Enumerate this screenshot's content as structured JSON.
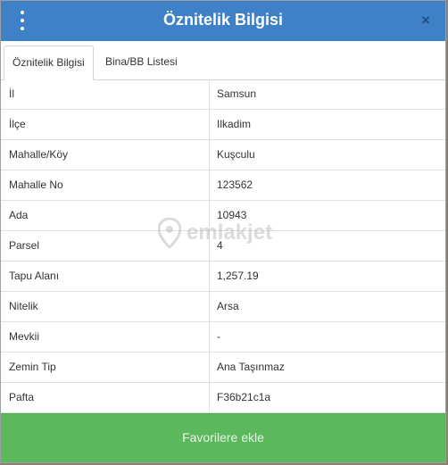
{
  "header": {
    "title": "Öznitelik Bilgisi",
    "menu_icon": "kebab-menu-icon",
    "close_label": "×"
  },
  "tabs": [
    {
      "label": "Öznitelik Bilgisi",
      "active": true
    },
    {
      "label": "Bina/BB Listesi",
      "active": false
    }
  ],
  "rows": [
    {
      "label": "İl",
      "value": "Samsun"
    },
    {
      "label": "İlçe",
      "value": "Ilkadim"
    },
    {
      "label": "Mahalle/Köy",
      "value": "Kuşculu"
    },
    {
      "label": "Mahalle No",
      "value": "123562"
    },
    {
      "label": "Ada",
      "value": "10943"
    },
    {
      "label": "Parsel",
      "value": "4"
    },
    {
      "label": "Tapu Alanı",
      "value": "1,257.19"
    },
    {
      "label": "Nitelik",
      "value": "Arsa"
    },
    {
      "label": "Mevkii",
      "value": "-"
    },
    {
      "label": "Zemin Tip",
      "value": "Ana Taşınmaz"
    },
    {
      "label": "Pafta",
      "value": "F36b21c1a"
    }
  ],
  "watermark": {
    "text": "emlakjet"
  },
  "footer": {
    "button_label": "Favorilere ekle"
  },
  "colors": {
    "header": "#3f81c6",
    "button": "#5cb85c"
  }
}
